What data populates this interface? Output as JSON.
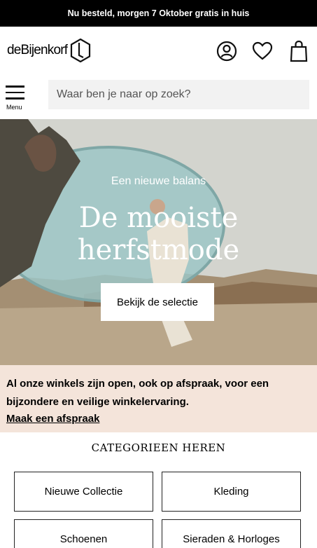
{
  "topbar": {
    "text": "Nu besteld, morgen 7 Oktober gratis in huis"
  },
  "header": {
    "logo_text": "deBijenkorf",
    "icons": [
      "account-icon",
      "heart-icon",
      "bag-icon"
    ]
  },
  "search": {
    "menu_label": "Menu",
    "placeholder": "Waar ben je naar op zoek?"
  },
  "hero": {
    "subtitle": "Een nieuwe balans",
    "title_line1": "De mooiste",
    "title_line2": "herfstmode",
    "button": "Bekijk de selectie"
  },
  "notice": {
    "text": "Al onze winkels zijn open, ook op afspraak, voor een bijzondere en veilige winkelervaring.",
    "link": "Maak een afspraak"
  },
  "categories": {
    "title": "CATEGORIEEN HEREN",
    "items": [
      "Nieuwe Collectie",
      "Kleding",
      "Schoenen",
      "Sieraden & Horloges"
    ]
  }
}
